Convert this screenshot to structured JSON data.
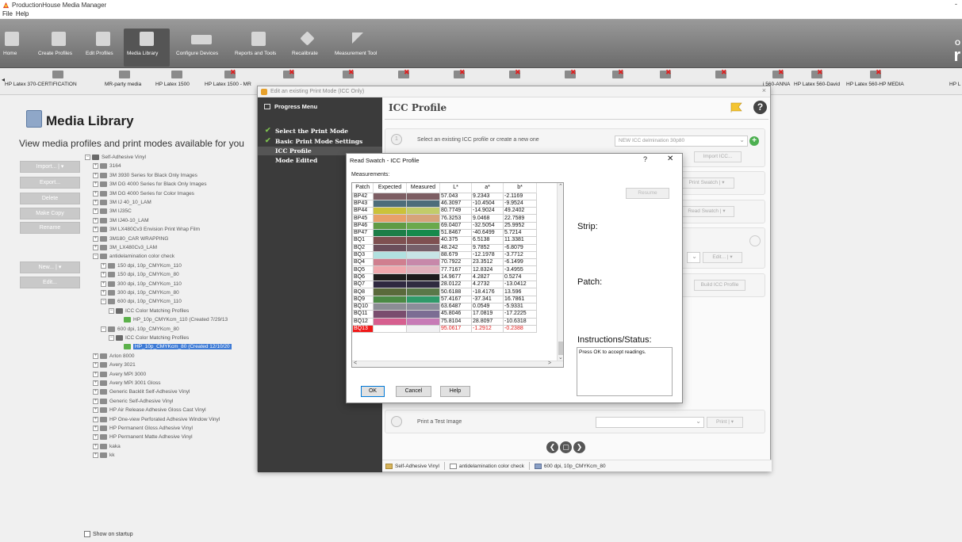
{
  "window": {
    "title": "ProductionHouse Media Manager",
    "close": "-"
  },
  "menu": [
    "File",
    "Help"
  ],
  "toolbar": {
    "buttons": [
      {
        "label": "Home"
      },
      {
        "label": "Create Profiles"
      },
      {
        "label": "Edit Profiles"
      },
      {
        "label": "Media Library"
      },
      {
        "label": "Configure Devices"
      },
      {
        "label": "Reports and Tools"
      },
      {
        "label": "Recalibrate"
      },
      {
        "label": "Measurement Tool"
      }
    ],
    "brand_small": "O",
    "brand_large": "r"
  },
  "media_strip": {
    "chips": [
      {
        "label": "HP Latex 370-CERTIFICATION"
      },
      {
        "label": "MR-party media"
      },
      {
        "label": "HP Latex 1500"
      },
      {
        "label": "HP Latex 1500 - MR"
      },
      {
        "label": "i 560-ANNA"
      },
      {
        "label": "HP Latex 560-David"
      },
      {
        "label": "HP Latex 560-HP MEDIA"
      },
      {
        "label": "HP L"
      }
    ],
    "arrow": "◂"
  },
  "media_library": {
    "title": "Media Library",
    "subtitle": "View media profiles and print modes available for you",
    "buttons": [
      "Import...  | ▾",
      "Export...",
      "Delete",
      "Make Copy",
      "Rename",
      "New...  | ▾",
      "Edit..."
    ],
    "tree": [
      {
        "label": "Self-Adhesive Vinyl",
        "exp": "⊟",
        "indent": 0,
        "icon": "folder"
      },
      {
        "label": "3164",
        "exp": "⊞",
        "indent": 1
      },
      {
        "label": "3M 3930 Series for Black Only Images",
        "exp": "⊞",
        "indent": 1
      },
      {
        "label": "3M DG 4000 Series for Black Only Images",
        "exp": "⊞",
        "indent": 1
      },
      {
        "label": "3M DG 4000 Series for Color Images",
        "exp": "⊞",
        "indent": 1
      },
      {
        "label": "3M IJ 40_10_LAM",
        "exp": "⊞",
        "indent": 1
      },
      {
        "label": "3M IJ35C",
        "exp": "⊞",
        "indent": 1
      },
      {
        "label": "3M IJ40-10_LAM",
        "exp": "⊞",
        "indent": 1
      },
      {
        "label": "3M LX480Cv3 Envision Print Wrap Film",
        "exp": "⊞",
        "indent": 1
      },
      {
        "label": "3M180_CAR WRAPPING",
        "exp": "⊞",
        "indent": 1
      },
      {
        "label": "3M_LX480Cv3_LAM",
        "exp": "⊞",
        "indent": 1
      },
      {
        "label": "antidelamination color check",
        "exp": "⊟",
        "indent": 1
      },
      {
        "label": "150 dpi, 10p_CMYKcm_110",
        "exp": "⊞",
        "indent": 2
      },
      {
        "label": "150 dpi, 10p_CMYKcm_80",
        "exp": "⊞",
        "indent": 2
      },
      {
        "label": "300 dpi, 10p_CMYKcm_110",
        "exp": "⊞",
        "indent": 2
      },
      {
        "label": "300 dpi, 10p_CMYKcm_80",
        "exp": "⊞",
        "indent": 2
      },
      {
        "label": "600 dpi, 10p_CMYKcm_110",
        "exp": "⊟",
        "indent": 2
      },
      {
        "label": "ICC Color Matching Profiles",
        "exp": "⊟",
        "indent": 3,
        "icon": "folder"
      },
      {
        "label": "HP_10p_CMYKcm_110 (Created 7/29/13",
        "exp": "",
        "indent": 4,
        "icon": "check"
      },
      {
        "label": "600 dpi, 10p_CMYKcm_80",
        "exp": "⊟",
        "indent": 2
      },
      {
        "label": "ICC Color Matching Profiles",
        "exp": "⊟",
        "indent": 3,
        "icon": "folder"
      },
      {
        "label": "HP_10p_CMYKcm_80 (Created 12/10/20",
        "exp": "",
        "indent": 4,
        "icon": "check",
        "selected": true
      },
      {
        "label": "Arlon 8000",
        "exp": "⊞",
        "indent": 1
      },
      {
        "label": "Avery 3021",
        "exp": "⊞",
        "indent": 1
      },
      {
        "label": "Avery MPI 3000",
        "exp": "⊞",
        "indent": 1
      },
      {
        "label": "Avery MPI 3001 Gloss",
        "exp": "⊞",
        "indent": 1
      },
      {
        "label": "Generic Backlit Self-Adhesive Vinyl",
        "exp": "⊞",
        "indent": 1
      },
      {
        "label": "Generic Self-Adhesive Vinyl",
        "exp": "⊞",
        "indent": 1
      },
      {
        "label": "HP Air Release Adhesive Gloss Cast Vinyl",
        "exp": "⊞",
        "indent": 1
      },
      {
        "label": "HP One-view Perforated Adhesive Window Vinyl",
        "exp": "⊞",
        "indent": 1
      },
      {
        "label": "HP Permanent Gloss Adhesive Vinyl",
        "exp": "⊞",
        "indent": 1
      },
      {
        "label": "HP Permanent Matte Adhesive Vinyl",
        "exp": "⊞",
        "indent": 1
      },
      {
        "label": "kaka",
        "exp": "⊞",
        "indent": 1
      },
      {
        "label": "kk",
        "exp": "⊞",
        "indent": 1
      }
    ],
    "show_on_startup": "Show on startup"
  },
  "edit_dialog": {
    "title": "Edit an existing Print Mode (ICC Only)",
    "close": "×",
    "progress_menu": "Progress Menu",
    "steps": [
      {
        "label": "Select the Print Mode",
        "done": true
      },
      {
        "label": "Basic Print Mode Settings",
        "done": true
      },
      {
        "label": "ICC Profile",
        "current": true
      },
      {
        "label": "Mode Edited"
      }
    ],
    "heading": "ICC Profile",
    "help": "?",
    "step1_num": "1",
    "step1_text": "Select an existing ICC profile or create a new one",
    "icc_combo": "NEW ICC delmination 30p80",
    "plus": "+",
    "import_icc": "Import ICC...",
    "print_swatch": "Print Swatch  | ▾",
    "read_swatch": "Read Swatch  | ▾",
    "edit_btn": "Edit...  | ▾",
    "build_icc": "Build ICC Profile",
    "test_image": "Print a Test Image",
    "print_btn": "Print  | ▾",
    "nav": [
      "❮",
      "▢",
      "❯"
    ],
    "status": [
      {
        "label": "Self-Adhesive Vinyl",
        "icon": "folder"
      },
      {
        "label": "antidelamination color check",
        "icon": "doc"
      },
      {
        "label": "600 dpi, 10p_CMYKcm_80",
        "icon": "grid"
      }
    ]
  },
  "swatch_dialog": {
    "title": "Read Swatch - ICC Profile",
    "help": "?",
    "close": "✕",
    "measurements_label": "Measurements:",
    "columns": [
      "Patch",
      "Expected",
      "Measured",
      "L*",
      "a*",
      "b*"
    ],
    "rows": [
      {
        "patch": "BP42",
        "expected": "#7d5e63",
        "measured": "#7d5e63",
        "L": "57.043",
        "a": "9.2343",
        "b": "-2.1169"
      },
      {
        "patch": "BP43",
        "expected": "#4d6d7a",
        "measured": "#4d6d7a",
        "L": "46.3097",
        "a": "-10.4504",
        "b": "-9.9524"
      },
      {
        "patch": "BP44",
        "expected": "#cbc23a",
        "measured": "#c2cc6a",
        "L": "80.7749",
        "a": "-14.9024",
        "b": "49.2402"
      },
      {
        "patch": "BP45",
        "expected": "#e8a06a",
        "measured": "#d6a47a",
        "L": "76.3253",
        "a": "9.0468",
        "b": "22.7589"
      },
      {
        "patch": "BP46",
        "expected": "#5f9b45",
        "measured": "#6aa94c",
        "L": "69.0407",
        "a": "-32.5054",
        "b": "25.9952"
      },
      {
        "patch": "BP47",
        "expected": "#1d7e48",
        "measured": "#168a4c",
        "L": "51.8467",
        "a": "-40.6499",
        "b": "5.7214"
      },
      {
        "patch": "BQ1",
        "expected": "#7f5051",
        "measured": "#7f5051",
        "L": "40.375",
        "a": "6.5138",
        "b": "11.3381"
      },
      {
        "patch": "BQ2",
        "expected": "#6b4e5b",
        "measured": "#76606a",
        "L": "48.242",
        "a": "9.7852",
        "b": "-6.8079"
      },
      {
        "patch": "BQ3",
        "expected": "#b1e1e0",
        "measured": "#c7e4e6",
        "L": "88.679",
        "a": "-12.1978",
        "b": "-3.7712"
      },
      {
        "patch": "BQ4",
        "expected": "#d07f8f",
        "measured": "#c788aa",
        "L": "70.7922",
        "a": "23.3512",
        "b": "-6.1499"
      },
      {
        "patch": "BQ5",
        "expected": "#f0a8ad",
        "measured": "#e0b0bb",
        "L": "77.7167",
        "a": "12.8324",
        "b": "-3.4955"
      },
      {
        "patch": "BQ6",
        "expected": "#201e1d",
        "measured": "#1e1b1c",
        "L": "14.9677",
        "a": "4.2827",
        "b": "0.5274"
      },
      {
        "patch": "BQ7",
        "expected": "#2f2940",
        "measured": "#2f2b40",
        "L": "28.0122",
        "a": "4.2732",
        "b": "-13.0412"
      },
      {
        "patch": "BQ8",
        "expected": "#5a6a3b",
        "measured": "#5a7849",
        "L": "50.6188",
        "a": "-18.4176",
        "b": "13.596"
      },
      {
        "patch": "BQ9",
        "expected": "#4b8a45",
        "measured": "#2f9a6a",
        "L": "57.4167",
        "a": "-37.341",
        "b": "16.7861"
      },
      {
        "patch": "BQ10",
        "expected": "#8c8d95",
        "measured": "#8b8d9a",
        "L": "63.6487",
        "a": "0.0549",
        "b": "-5.9331"
      },
      {
        "patch": "BQ11",
        "expected": "#7a4d6e",
        "measured": "#7b6d93",
        "L": "45.8046",
        "a": "17.0819",
        "b": "-17.2225"
      },
      {
        "patch": "BQ12",
        "expected": "#d65f8f",
        "measured": "#c77bb6",
        "L": "75.8104",
        "a": "28.8097",
        "b": "-10.6318"
      },
      {
        "patch": "BQ13",
        "expected": "#ffffff",
        "measured": "#f1f1f3",
        "L": "95.0617",
        "a": "-1.2912",
        "b": "-0.2388",
        "error": true
      }
    ],
    "resume": "Resume",
    "strip_label": "Strip:",
    "patch_label": "Patch:",
    "instructions_label": "Instructions/Status:",
    "status_text": "Press OK to accept readings.",
    "ok": "OK",
    "cancel": "Cancel",
    "help_btn": "Help"
  }
}
